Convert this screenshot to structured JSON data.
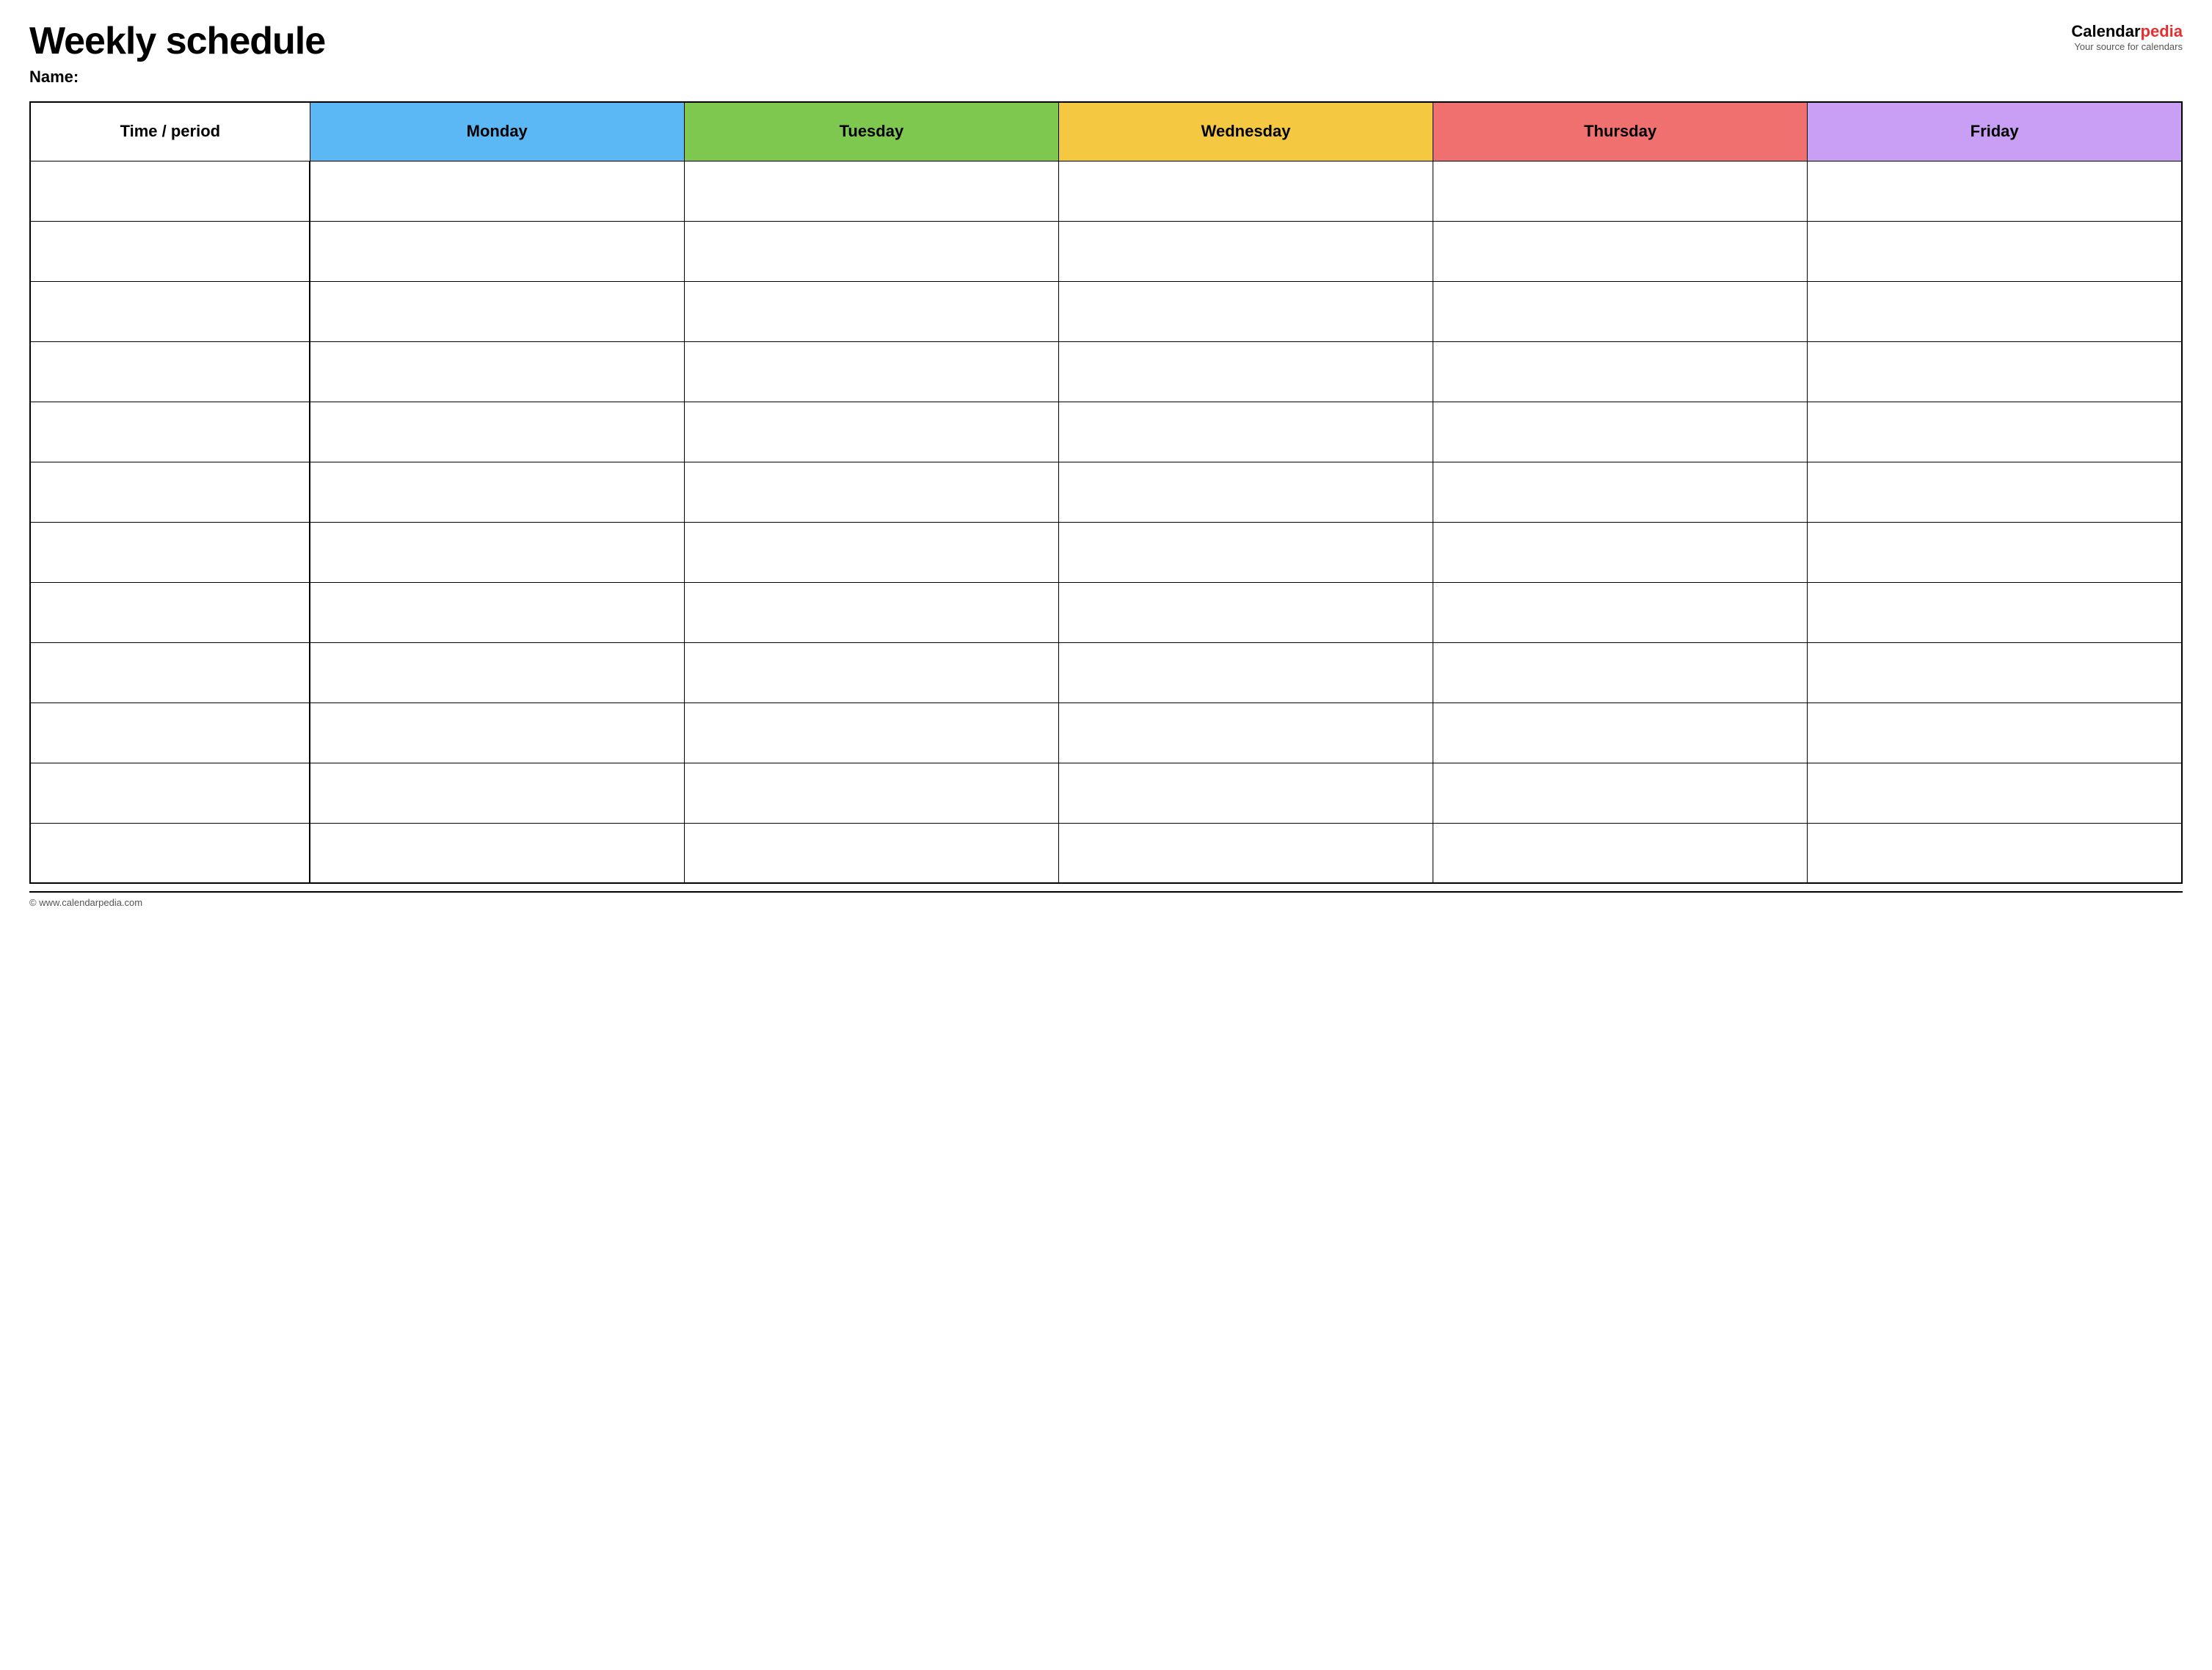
{
  "header": {
    "title": "Weekly schedule",
    "name_label": "Name:",
    "logo_calendar": "Calendar",
    "logo_pedia": "pedia",
    "logo_tagline": "Your source for calendars"
  },
  "table": {
    "columns": [
      {
        "id": "time",
        "label": "Time / period",
        "color": "#ffffff"
      },
      {
        "id": "monday",
        "label": "Monday",
        "color": "#5bb8f5"
      },
      {
        "id": "tuesday",
        "label": "Tuesday",
        "color": "#7ec850"
      },
      {
        "id": "wednesday",
        "label": "Wednesday",
        "color": "#f5c842"
      },
      {
        "id": "thursday",
        "label": "Thursday",
        "color": "#f07070"
      },
      {
        "id": "friday",
        "label": "Friday",
        "color": "#c89ff5"
      }
    ],
    "row_count": 12
  },
  "footer": {
    "url": "© www.calendarpedia.com"
  }
}
